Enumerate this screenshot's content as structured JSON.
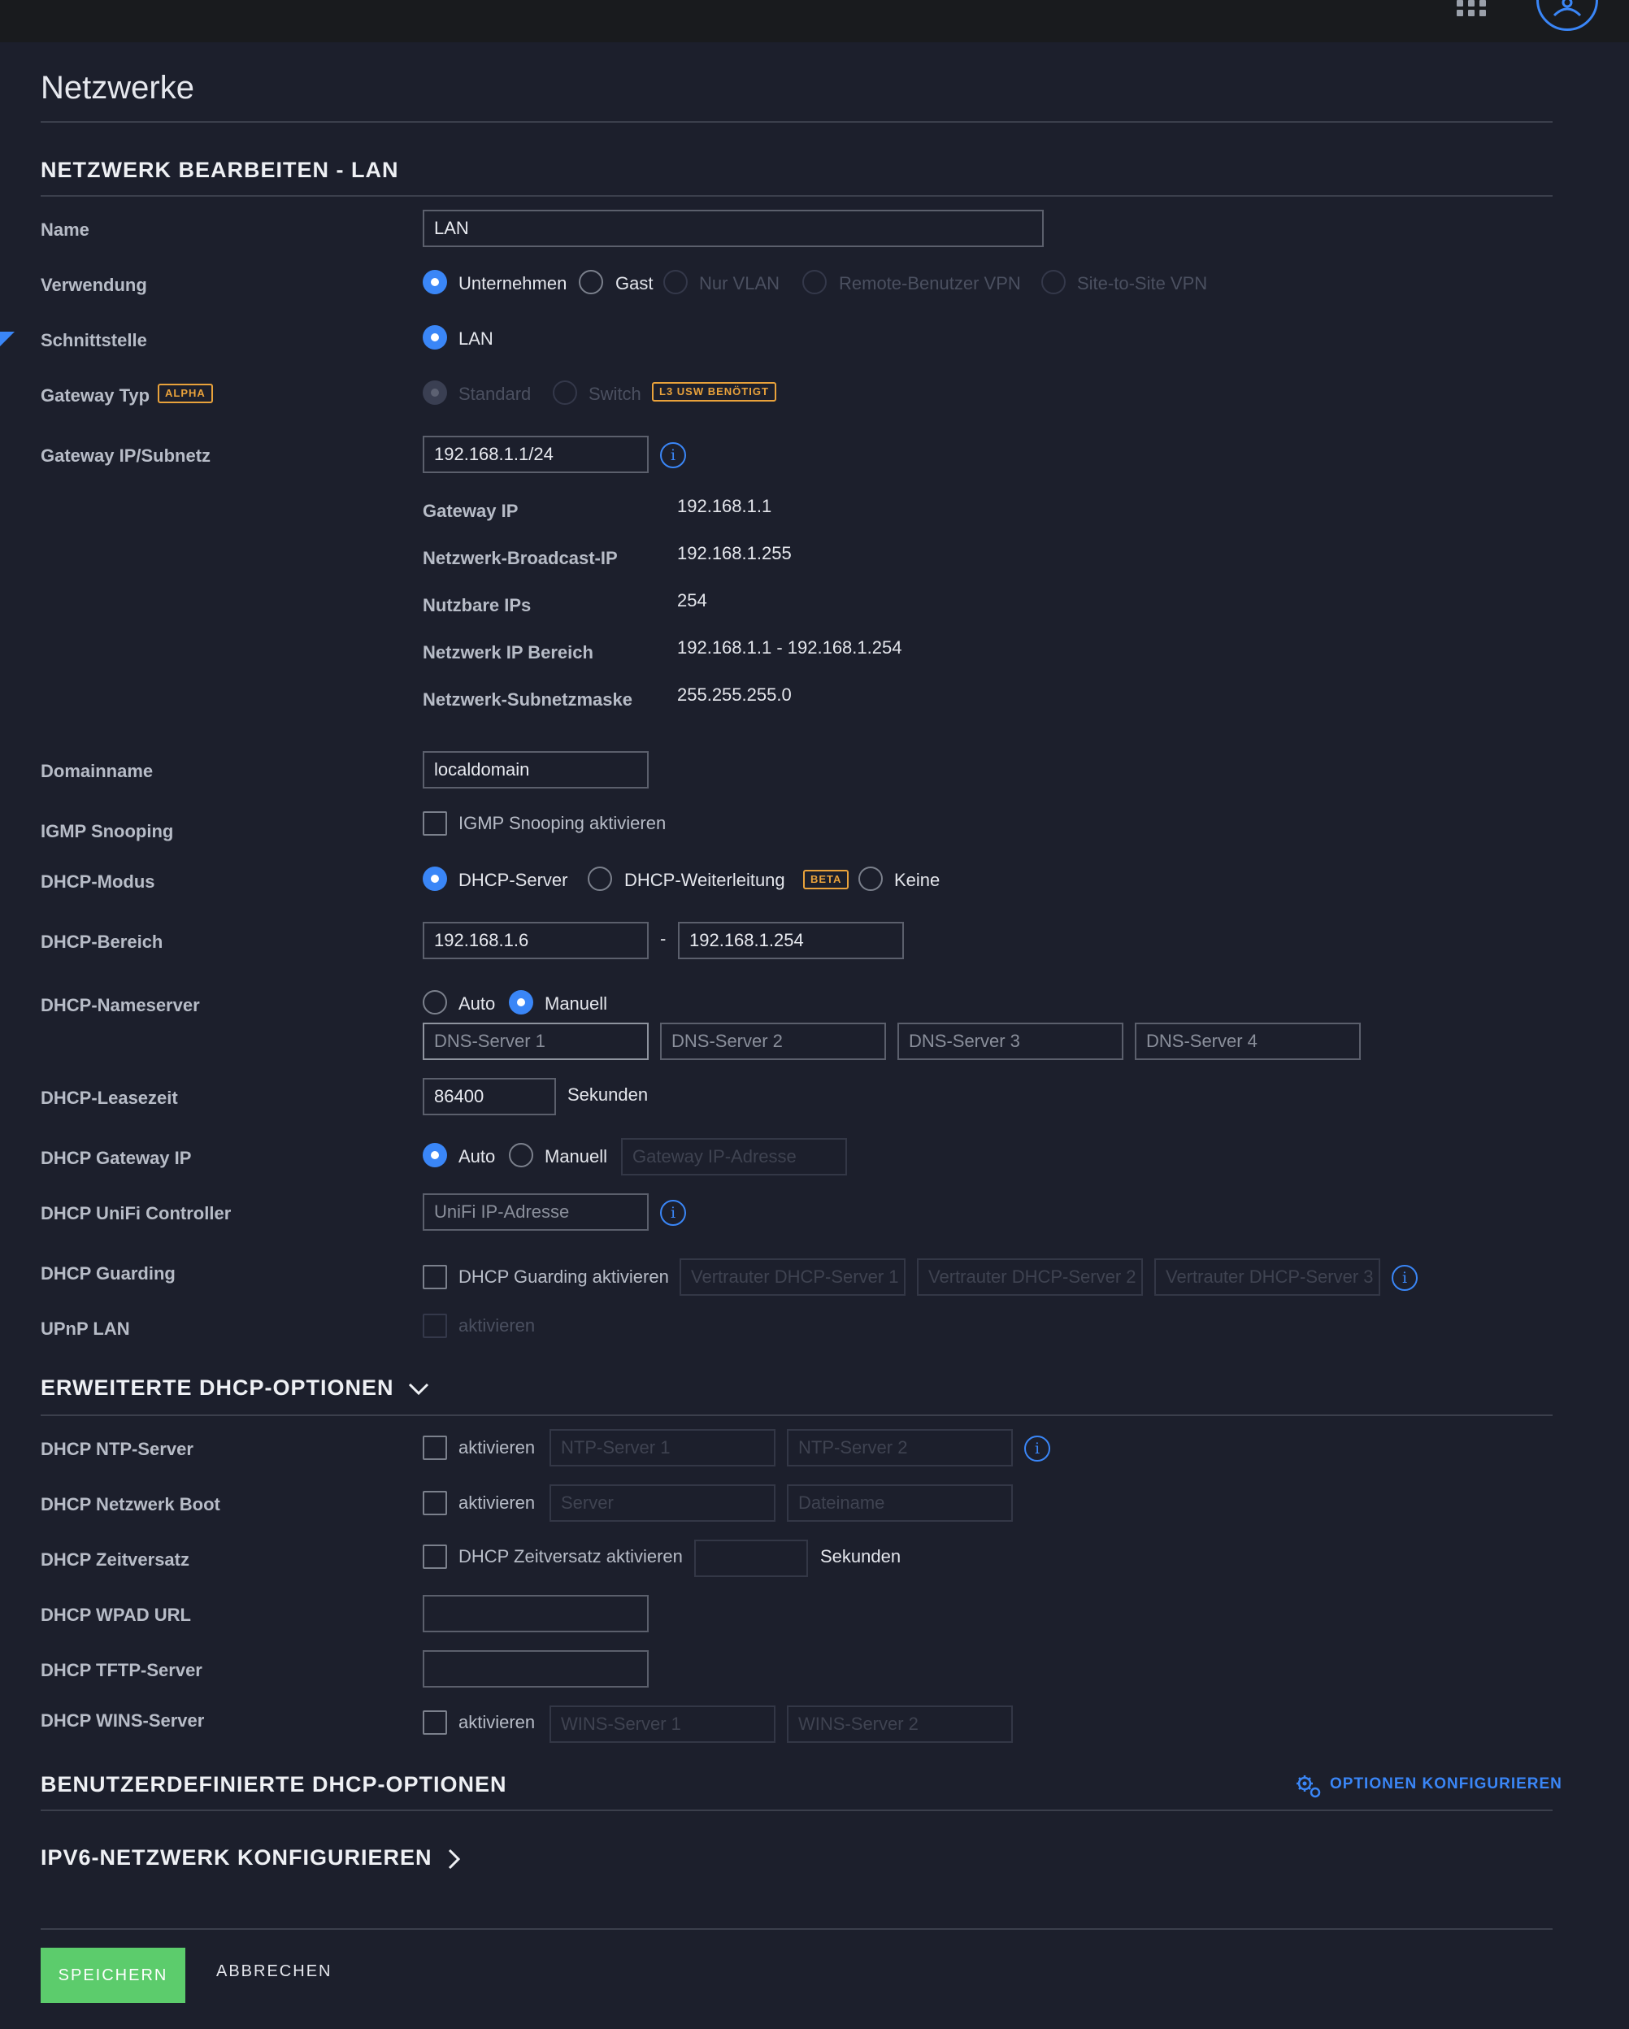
{
  "page": {
    "title": "Netzwerke"
  },
  "section": {
    "edit_title": "NETZWERK BEARBEITEN - LAN"
  },
  "name": {
    "label": "Name",
    "value": "LAN"
  },
  "purpose": {
    "label": "Verwendung",
    "options": [
      "Unternehmen",
      "Gast",
      "Nur VLAN",
      "Remote-Benutzer VPN",
      "Site-to-Site VPN"
    ],
    "selected": "Unternehmen"
  },
  "interface": {
    "label": "Schnittstelle",
    "option": "LAN"
  },
  "gateway_type": {
    "label": "Gateway Typ",
    "badge": "ALPHA",
    "options": [
      "Standard",
      "Switch"
    ],
    "switch_badge": "L3 USW BENÖTIGT"
  },
  "gateway_subnet": {
    "label": "Gateway IP/Subnetz",
    "value": "192.168.1.1/24",
    "details": [
      {
        "label": "Gateway IP",
        "value": "192.168.1.1"
      },
      {
        "label": "Netzwerk-Broadcast-IP",
        "value": "192.168.1.255"
      },
      {
        "label": "Nutzbare IPs",
        "value": "254"
      },
      {
        "label": "Netzwerk IP Bereich",
        "value": "192.168.1.1 - 192.168.1.254"
      },
      {
        "label": "Netzwerk-Subnetzmaske",
        "value": "255.255.255.0"
      }
    ]
  },
  "domain": {
    "label": "Domainname",
    "value": "localdomain"
  },
  "igmp": {
    "label": "IGMP Snooping",
    "checkbox": "IGMP Snooping aktivieren"
  },
  "dhcp_mode": {
    "label": "DHCP-Modus",
    "options": [
      "DHCP-Server",
      "DHCP-Weiterleitung",
      "Keine"
    ],
    "badge": "BETA",
    "selected": "DHCP-Server"
  },
  "dhcp_range": {
    "label": "DHCP-Bereich",
    "start": "192.168.1.6",
    "separator": "-",
    "end": "192.168.1.254"
  },
  "dhcp_dns": {
    "label": "DHCP-Nameserver",
    "options": [
      "Auto",
      "Manuell"
    ],
    "selected": "Manuell",
    "placeholders": [
      "DNS-Server 1",
      "DNS-Server 2",
      "DNS-Server 3",
      "DNS-Server 4"
    ]
  },
  "dhcp_lease": {
    "label": "DHCP-Leasezeit",
    "value": "86400",
    "unit": "Sekunden"
  },
  "dhcp_gateway": {
    "label": "DHCP Gateway IP",
    "options": [
      "Auto",
      "Manuell"
    ],
    "selected": "Auto",
    "placeholder": "Gateway IP-Adresse"
  },
  "dhcp_controller": {
    "label": "DHCP UniFi Controller",
    "placeholder": "UniFi IP-Adresse"
  },
  "dhcp_guarding": {
    "label": "DHCP Guarding",
    "checkbox": "DHCP Guarding aktivieren",
    "placeholders": [
      "Vertrauter DHCP-Server 1",
      "Vertrauter DHCP-Server 2",
      "Vertrauter DHCP-Server 3"
    ]
  },
  "upnp": {
    "label": "UPnP LAN",
    "checkbox": "aktivieren"
  },
  "advanced": {
    "title": "ERWEITERTE DHCP-OPTIONEN"
  },
  "ntp": {
    "label": "DHCP NTP-Server",
    "checkbox": "aktivieren",
    "placeholders": [
      "NTP-Server 1",
      "NTP-Server 2"
    ]
  },
  "netboot": {
    "label": "DHCP Netzwerk Boot",
    "checkbox": "aktivieren",
    "placeholders": [
      "Server",
      "Dateiname"
    ]
  },
  "time_offset": {
    "label": "DHCP Zeitversatz",
    "checkbox": "DHCP Zeitversatz aktivieren",
    "unit": "Sekunden"
  },
  "wpad": {
    "label": "DHCP WPAD URL"
  },
  "tftp": {
    "label": "DHCP TFTP-Server"
  },
  "wins": {
    "label": "DHCP WINS-Server",
    "checkbox": "aktivieren",
    "placeholders": [
      "WINS-Server 1",
      "WINS-Server 2"
    ]
  },
  "custom": {
    "title": "BENUTZERDEFINIERTE DHCP-OPTIONEN",
    "link": "OPTIONEN KONFIGURIEREN"
  },
  "ipv6": {
    "title": "IPV6-NETZWERK KONFIGURIEREN"
  },
  "actions": {
    "save": "SPEICHERN",
    "cancel": "ABBRECHEN"
  },
  "colors": {
    "accent": "#3a86f7",
    "save": "#5ccc6c",
    "badge": "#e9a23b",
    "background": "#1c1f2c"
  },
  "icons": [
    "grid-icon",
    "user-avatar-icon",
    "info-icon",
    "chevron-down-icon",
    "chevron-right-icon",
    "gears-icon"
  ]
}
